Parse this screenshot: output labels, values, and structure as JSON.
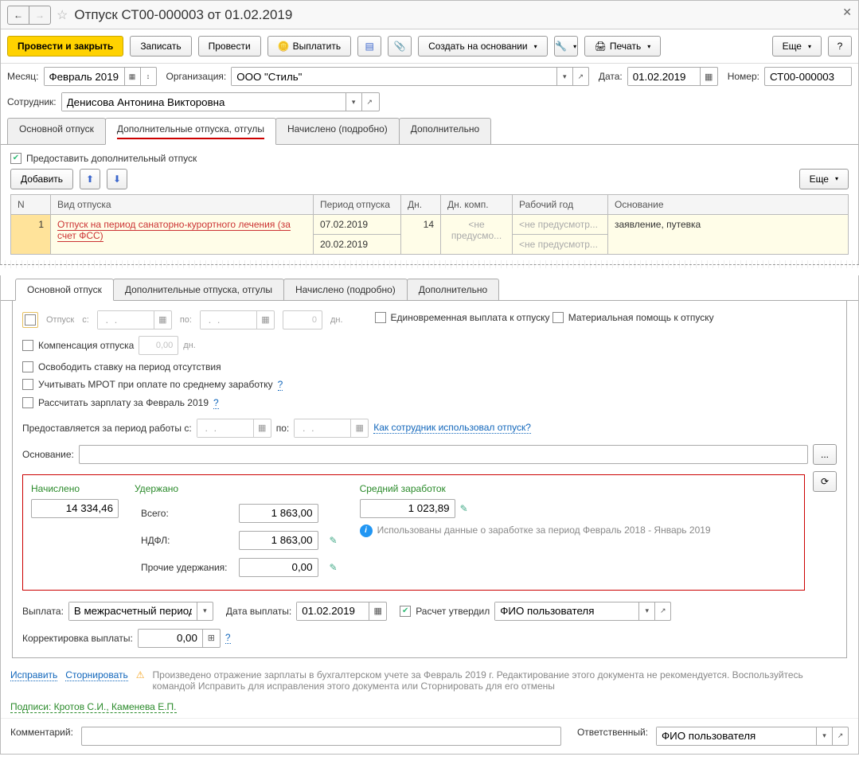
{
  "title": "Отпуск СТ00-000003 от 01.02.2019",
  "toolbar": {
    "executeClose": "Провести и закрыть",
    "save": "Записать",
    "execute": "Провести",
    "payout": "Выплатить",
    "createBased": "Создать на основании",
    "print": "Печать",
    "more": "Еще",
    "help": "?"
  },
  "header": {
    "monthLabel": "Месяц:",
    "month": "Февраль 2019",
    "orgLabel": "Организация:",
    "org": "ООО \"Стиль\"",
    "dateLabel": "Дата:",
    "date": "01.02.2019",
    "numberLabel": "Номер:",
    "number": "СТ00-000003",
    "employeeLabel": "Сотрудник:",
    "employee": "Денисова Антонина Викторовна"
  },
  "tabs1": {
    "t1": "Основной отпуск",
    "t2": "Дополнительные отпуска, отгулы",
    "t3": "Начислено (подробно)",
    "t4": "Дополнительно"
  },
  "addl": {
    "provide": "Предоставить дополнительный отпуск",
    "add": "Добавить",
    "more": "Еще",
    "cols": {
      "n": "N",
      "type": "Вид отпуска",
      "period": "Период отпуска",
      "days": "Дн.",
      "compDays": "Дн. комп.",
      "workYear": "Рабочий год",
      "basis": "Основание"
    },
    "row": {
      "n": "1",
      "type": "Отпуск на период санаторно-курортного лечения (за счет ФСС)",
      "from": "07.02.2019",
      "to": "20.02.2019",
      "days": "14",
      "comp": "<не предусмо...",
      "wy1": "<не предусмотр...",
      "wy2": "<не предусмотр...",
      "basis": "заявление, путевка"
    }
  },
  "tabs2": {
    "t1": "Основной отпуск",
    "t2": "Дополнительные отпуска, отгулы",
    "t3": "Начислено (подробно)",
    "t4": "Дополнительно"
  },
  "main": {
    "vacation": "Отпуск",
    "from": "с:",
    "to": "по:",
    "daysVal": "0",
    "daysUnit": "дн.",
    "lump": "Единовременная выплата к отпуску",
    "aid": "Материальная помощь к отпуску",
    "comp": "Компенсация отпуска",
    "compVal": "0,00",
    "compUnit": "дн.",
    "freeRate": "Освободить ставку на период отсутствия",
    "mrot": "Учитывать МРОТ при оплате по среднему заработку",
    "calcSalary": "Рассчитать зарплату за Февраль 2019",
    "periodLabel": "Предоставляется за период работы с:",
    "periodTo": "по:",
    "howUsed": "Как сотрудник использовал отпуск?",
    "basisLabel": "Основание:"
  },
  "calc": {
    "accrued": "Начислено",
    "accruedVal": "14 334,46",
    "withheld": "Удержано",
    "totalLabel": "Всего:",
    "totalVal": "1 863,00",
    "ndflLabel": "НДФЛ:",
    "ndflVal": "1 863,00",
    "otherLabel": "Прочие удержания:",
    "otherVal": "0,00",
    "avg": "Средний заработок",
    "avgVal": "1 023,89",
    "note": "Использованы данные о заработке за период Февраль 2018 - Январь 2019"
  },
  "payout": {
    "label": "Выплата:",
    "value": "В межрасчетный период",
    "dateLabel": "Дата выплаты:",
    "date": "01.02.2019",
    "approved": "Расчет утвердил",
    "approver": "ФИО пользователя",
    "corrLabel": "Корректировка выплаты:",
    "corrVal": "0,00"
  },
  "footer": {
    "correct": "Исправить",
    "storno": "Сторнировать",
    "warn": "Произведено отражение зарплаты в бухгалтерском учете за Февраль 2019 г. Редактирование этого документа не рекомендуется. Воспользуйтесь командой Исправить для исправления этого документа или Сторнировать для его отмены",
    "sign": "Подписи: Кротов С.И., Каменева Е.П.",
    "commentLabel": "Комментарий:",
    "respLabel": "Ответственный:",
    "resp": "ФИО пользователя"
  }
}
